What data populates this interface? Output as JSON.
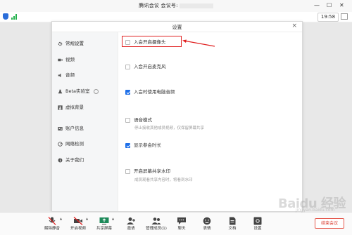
{
  "window": {
    "title": "腾讯会议 会议号:",
    "minimize": "—",
    "maximize": "☐",
    "close": "✕"
  },
  "status": {
    "time": "19:58"
  },
  "dialog": {
    "title": "设置",
    "close": "×",
    "sidebar": [
      {
        "label": "常规设置",
        "icon": "gear-icon"
      },
      {
        "label": "视频",
        "icon": "camera-icon"
      },
      {
        "label": "音频",
        "icon": "speaker-icon"
      },
      {
        "label": "Beta实验室",
        "icon": "flask-icon"
      },
      {
        "label": "虚拟背景",
        "icon": "person-bg-icon"
      },
      {
        "label": "账户信息",
        "icon": "account-icon"
      },
      {
        "label": "网络检测",
        "icon": "network-icon"
      },
      {
        "label": "关于我们",
        "icon": "info-icon"
      }
    ],
    "options": [
      {
        "label": "入会开启摄像头",
        "checked": false
      },
      {
        "label": "入会开启麦克风",
        "checked": false
      },
      {
        "label": "入会时使用电脑音频",
        "checked": true
      },
      {
        "label": "语音模式",
        "checked": false,
        "desc": "停止接收其他成员视频，仅保留屏幕共享"
      },
      {
        "label": "显示参会时长",
        "checked": true
      },
      {
        "label": "开启屏幕共享水印",
        "checked": false,
        "desc": "成员观看共享内容时，将看到水印"
      }
    ]
  },
  "toolbar": {
    "items": [
      {
        "label": "解除静音",
        "icon": "mic-muted-icon"
      },
      {
        "label": "开启视频",
        "icon": "video-off-icon"
      },
      {
        "label": "共享屏幕",
        "icon": "share-screen-icon"
      },
      {
        "label": "邀请",
        "icon": "invite-icon"
      },
      {
        "label": "管理成员(1)",
        "icon": "members-icon"
      },
      {
        "label": "聊天",
        "icon": "chat-icon"
      },
      {
        "label": "表情",
        "icon": "emoji-icon"
      },
      {
        "label": "文档",
        "icon": "document-icon"
      },
      {
        "label": "设置",
        "icon": "settings-icon"
      }
    ],
    "end_label": "结束会议"
  },
  "watermark": {
    "brand": "Baidu 经验",
    "sub": "jingyan.baidu.com"
  },
  "colors": {
    "accent": "#1e6fe8",
    "highlight": "#e02020",
    "end": "#d9382b"
  }
}
